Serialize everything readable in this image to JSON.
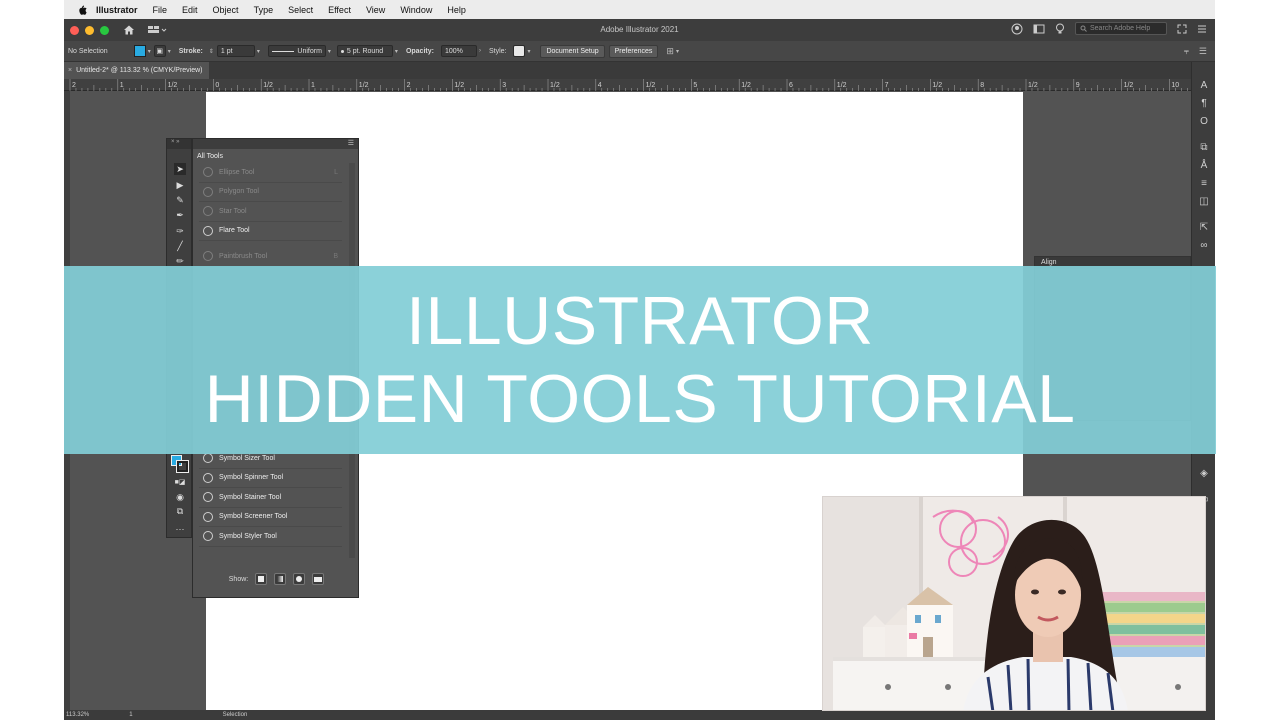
{
  "menubar": {
    "items": [
      "Illustrator",
      "File",
      "Edit",
      "Object",
      "Type",
      "Select",
      "Effect",
      "View",
      "Window",
      "Help"
    ]
  },
  "appbar": {
    "title": "Adobe Illustrator 2021",
    "search_placeholder": "Search Adobe Help"
  },
  "controlbar": {
    "selection": "No Selection",
    "stroke_label": "Stroke:",
    "stroke_value": "1 pt",
    "profile": "Uniform",
    "brush": "5 pt. Round",
    "opacity_label": "Opacity:",
    "opacity_value": "100%",
    "style_label": "Style:",
    "document_setup": "Document Setup",
    "preferences": "Preferences",
    "fill_color": "#29abe2"
  },
  "document": {
    "tab_title": "Untitled-2* @ 113.32 % (CMYK/Preview)"
  },
  "ruler": {
    "labels": [
      "2",
      "1",
      "1/2",
      "0",
      "1/2",
      "1",
      "1/2",
      "2",
      "1/2",
      "3",
      "1/2",
      "4",
      "1/2",
      "5",
      "1/2",
      "6",
      "1/2",
      "7",
      "1/2",
      "8",
      "1/2",
      "9",
      "1/2",
      "10",
      "1/2",
      "11"
    ]
  },
  "tools_panel": {
    "title": "All Tools",
    "items": [
      {
        "label": "Ellipse Tool",
        "key": "L",
        "dim": true
      },
      {
        "label": "Polygon Tool",
        "key": "",
        "dim": true
      },
      {
        "label": "Star Tool",
        "key": "",
        "dim": true
      },
      {
        "label": "Flare Tool",
        "key": "",
        "dim": false
      },
      {
        "label": "Paintbrush Tool",
        "key": "B",
        "dim": true
      }
    ],
    "lower_items": [
      {
        "label": "Symbol Sizer Tool"
      },
      {
        "label": "Symbol Spinner Tool"
      },
      {
        "label": "Symbol Stainer Tool"
      },
      {
        "label": "Symbol Screener Tool"
      },
      {
        "label": "Symbol Styler Tool"
      }
    ],
    "show_label": "Show:"
  },
  "align_panel": {
    "title": "Align"
  },
  "status": {
    "zoom": "113.32%",
    "artboard": "1",
    "tool": "Selection"
  },
  "banner": {
    "line1": "ILLUSTRATOR",
    "line2": "HIDDEN TOOLS TUTORIAL"
  }
}
